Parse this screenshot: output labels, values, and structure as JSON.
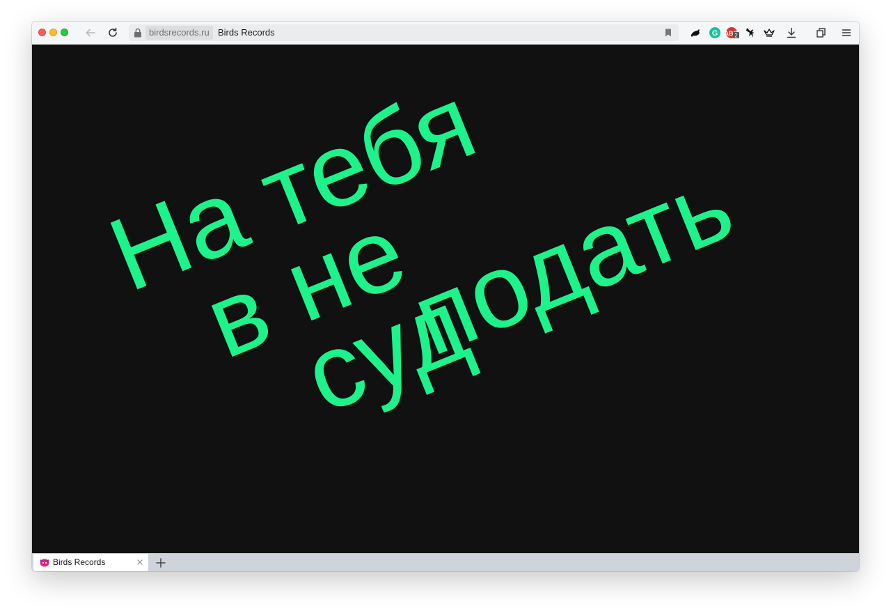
{
  "window": {
    "traffic_lights": [
      "close",
      "minimize",
      "maximize"
    ]
  },
  "toolbar": {
    "back_icon": "arrow-left-icon",
    "reload_icon": "reload-icon",
    "url": {
      "domain": "birdsrecords.ru",
      "page_title": "Birds Records",
      "lock_icon": "lock-icon",
      "bookmark_icon": "bookmark-icon"
    },
    "extensions": [
      {
        "name": "bird-extension-icon"
      },
      {
        "name": "grammarly-icon",
        "letter": "G"
      },
      {
        "name": "adblock-icon",
        "badge": "2"
      },
      {
        "name": "bird-silhouette-icon"
      },
      {
        "name": "crown-icon"
      },
      {
        "name": "download-icon"
      },
      {
        "name": "library-icon"
      },
      {
        "name": "menu-icon"
      }
    ]
  },
  "content": {
    "background": "#111111",
    "text_color": "#1ef28b",
    "words": [
      "На тебя",
      "не",
      "подать",
      "в",
      "суд"
    ]
  },
  "tabs": [
    {
      "title": "Birds Records",
      "favicon": "birds-favicon-icon",
      "active": true
    }
  ],
  "new_tab_icon": "plus-icon"
}
